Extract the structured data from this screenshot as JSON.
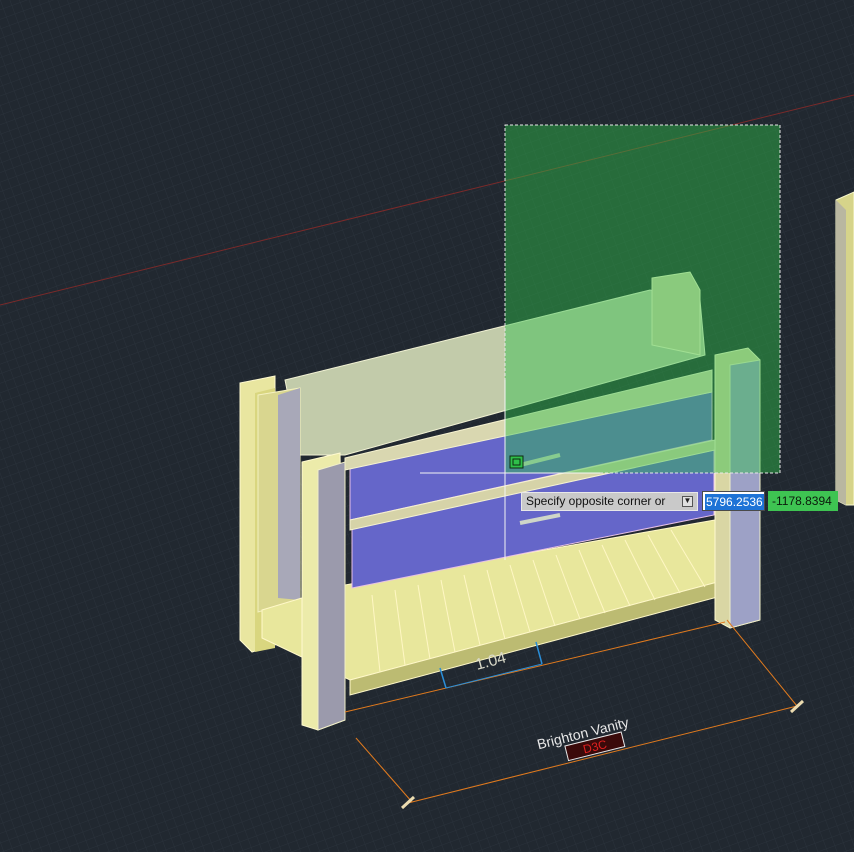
{
  "command": {
    "prompt": "Specify opposite corner or",
    "dropdown_icon": "down-arrow-icon",
    "x_value": "5796.2536",
    "y_value": "-1178.8394"
  },
  "drawing": {
    "title_text": "Brighton Vanity",
    "tag_text": "D3C",
    "inner_dimension": "1.04"
  },
  "colors": {
    "background": "#212830",
    "selection_window": "#1f6a33",
    "prompt_bg": "#c9c9c9",
    "coord_x_highlight": "#1e73d6",
    "coord_y_bg": "#3ec452",
    "drawer_fill": "#6566c9",
    "wood_fill": "#e6e49a",
    "dimension_line": "#e07a1e"
  }
}
